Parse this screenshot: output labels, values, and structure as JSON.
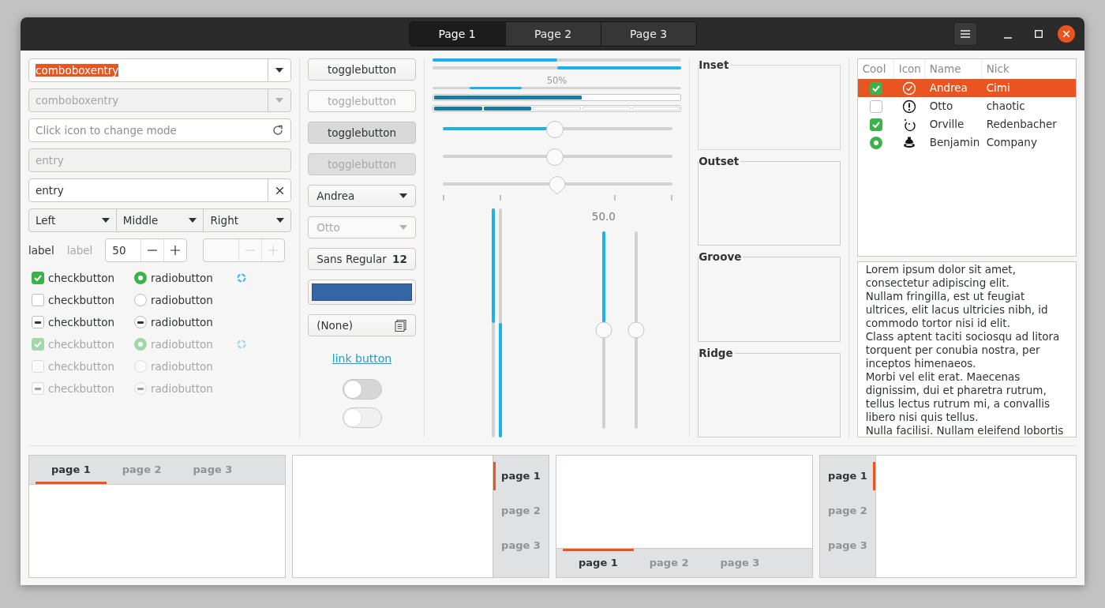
{
  "window": {
    "tabs": [
      {
        "label": "Page 1",
        "selected": true
      },
      {
        "label": "Page 2",
        "selected": false
      },
      {
        "label": "Page 3",
        "selected": false
      }
    ]
  },
  "entries": [
    {
      "kind": "combo",
      "value": "comboboxentry",
      "text_selected": true,
      "disabled": false
    },
    {
      "kind": "combo",
      "value": "comboboxentry",
      "text_selected": false,
      "disabled": true
    },
    {
      "kind": "refresh-entry",
      "placeholder": "Click icon to change mode",
      "disabled": false
    },
    {
      "kind": "entry",
      "value": "entry",
      "disabled": true
    },
    {
      "kind": "clear-entry",
      "value": "entry",
      "disabled": false
    }
  ],
  "segmented_combos": [
    "Left",
    "Middle",
    "Right"
  ],
  "labels": [
    {
      "text": "label",
      "disabled": false
    },
    {
      "text": "label",
      "disabled": true
    }
  ],
  "spin_buttons": [
    {
      "value": "50",
      "disabled": false
    },
    {
      "disabled": true
    }
  ],
  "checks": [
    {
      "label": "checkbutton",
      "checked": true,
      "inconsistent": false,
      "disabled": false
    },
    {
      "label": "checkbutton",
      "checked": false,
      "inconsistent": false,
      "disabled": false
    },
    {
      "label": "checkbutton",
      "checked": true,
      "inconsistent": true,
      "disabled": false
    },
    {
      "label": "checkbutton",
      "checked": true,
      "inconsistent": false,
      "disabled": true
    },
    {
      "label": "checkbutton",
      "checked": false,
      "inconsistent": false,
      "disabled": true
    },
    {
      "label": "checkbutton",
      "checked": true,
      "inconsistent": true,
      "disabled": true
    }
  ],
  "radios": [
    {
      "label": "radiobutton",
      "checked": true,
      "inconsistent": false,
      "disabled": false,
      "spinner": true
    },
    {
      "label": "radiobutton",
      "checked": false,
      "inconsistent": false,
      "disabled": false,
      "spinner": false
    },
    {
      "label": "radiobutton",
      "checked": true,
      "inconsistent": true,
      "disabled": false,
      "spinner": false
    },
    {
      "label": "radiobutton",
      "checked": true,
      "inconsistent": false,
      "disabled": true,
      "spinner": true
    },
    {
      "label": "radiobutton",
      "checked": false,
      "inconsistent": false,
      "disabled": true,
      "spinner": false
    },
    {
      "label": "radiobutton",
      "checked": true,
      "inconsistent": true,
      "disabled": true,
      "spinner": false
    }
  ],
  "toggles": [
    {
      "label": "togglebutton",
      "active": false,
      "disabled": false
    },
    {
      "label": "togglebutton",
      "active": false,
      "disabled": true
    },
    {
      "label": "togglebutton",
      "active": true,
      "disabled": false
    },
    {
      "label": "togglebutton",
      "active": true,
      "disabled": true
    }
  ],
  "combos": [
    {
      "value": "Andrea",
      "disabled": false
    },
    {
      "value": "Otto",
      "disabled": true
    }
  ],
  "font_button": {
    "name": "Sans Regular",
    "size": "12"
  },
  "color_button": {
    "color": "#3465a4"
  },
  "file_button": {
    "value": "(None)"
  },
  "link_button": {
    "label": "link button"
  },
  "switches": [
    {
      "on": false,
      "disabled": false
    },
    {
      "on": false,
      "disabled": true
    }
  ],
  "progress_bars": [
    {
      "kind": "bar",
      "level": 0.5,
      "inverted": false
    },
    {
      "kind": "bar",
      "level": 0.5,
      "inverted": true
    },
    {
      "kind": "pulse",
      "text": "50%"
    }
  ],
  "level_bars": [
    {
      "kind": "continuous",
      "level": 0.6
    },
    {
      "kind": "discrete",
      "level": 0.4
    }
  ],
  "scales": [
    {
      "level": 0.49,
      "filled": true,
      "marks": false
    },
    {
      "level": 0.49,
      "filled": false,
      "marks": false
    },
    {
      "level": 0.5,
      "filled": false,
      "marks": true
    }
  ],
  "vertical_progress": [
    {
      "level": 0.5,
      "inverted": false
    },
    {
      "level": 0.5,
      "inverted": true
    }
  ],
  "vertical_scales": [
    {
      "level": 0.5,
      "filled": true,
      "value_text": "50.0"
    },
    {
      "level": 0.5,
      "filled": false
    }
  ],
  "frames": [
    {
      "label": "Inset",
      "kind": "inset"
    },
    {
      "label": "Outset",
      "kind": "outset"
    },
    {
      "label": "Groove",
      "kind": "groove"
    },
    {
      "label": "Ridge",
      "kind": "ridge"
    }
  ],
  "tree": {
    "columns": [
      "Cool",
      "Icon",
      "Name",
      "Nick"
    ],
    "rows": [
      {
        "kind": "check",
        "checked": true,
        "name": "Andrea",
        "nick": "Cimi",
        "selected": true
      },
      {
        "kind": "check",
        "checked": false,
        "name": "Otto",
        "nick": "chaotic",
        "selected": false
      },
      {
        "kind": "check",
        "checked": true,
        "name": "Orville",
        "nick": "Redenbacher",
        "selected": false
      },
      {
        "kind": "radio",
        "checked": true,
        "name": "Benjamin",
        "nick": "Company",
        "selected": false
      }
    ]
  },
  "text_view": {
    "paragraphs": [
      "Lorem ipsum dolor sit amet, consectetur adipiscing elit.",
      "Nullam fringilla, est ut feugiat ultrices, elit lacus ultricies nibh, id commodo tortor nisi id elit.",
      "Class aptent taciti sociosqu ad litora torquent per conubia nostra, per inceptos himenaeos.",
      "Morbi vel elit erat. Maecenas dignissim, dui et pharetra rutrum, tellus lectus rutrum mi, a convallis libero nisi quis tellus.",
      "Nulla facilisi. Nullam eleifend lobortis"
    ]
  },
  "notebooks": [
    {
      "kind": "top",
      "tabs": [
        {
          "label": "page 1",
          "selected": true
        },
        {
          "label": "page 2",
          "selected": false
        },
        {
          "label": "page 3",
          "selected": false
        }
      ]
    },
    {
      "kind": "right",
      "tabs": [
        {
          "label": "page 1",
          "selected": true
        },
        {
          "label": "page 2",
          "selected": false
        },
        {
          "label": "page 3",
          "selected": false
        }
      ]
    },
    {
      "kind": "bottom",
      "tabs": [
        {
          "label": "page 1",
          "selected": true
        },
        {
          "label": "page 2",
          "selected": false
        },
        {
          "label": "page 3",
          "selected": false
        }
      ]
    },
    {
      "kind": "left",
      "tabs": [
        {
          "label": "page 1",
          "selected": true
        },
        {
          "label": "page 2",
          "selected": false
        },
        {
          "label": "page 3",
          "selected": false
        }
      ]
    }
  ]
}
